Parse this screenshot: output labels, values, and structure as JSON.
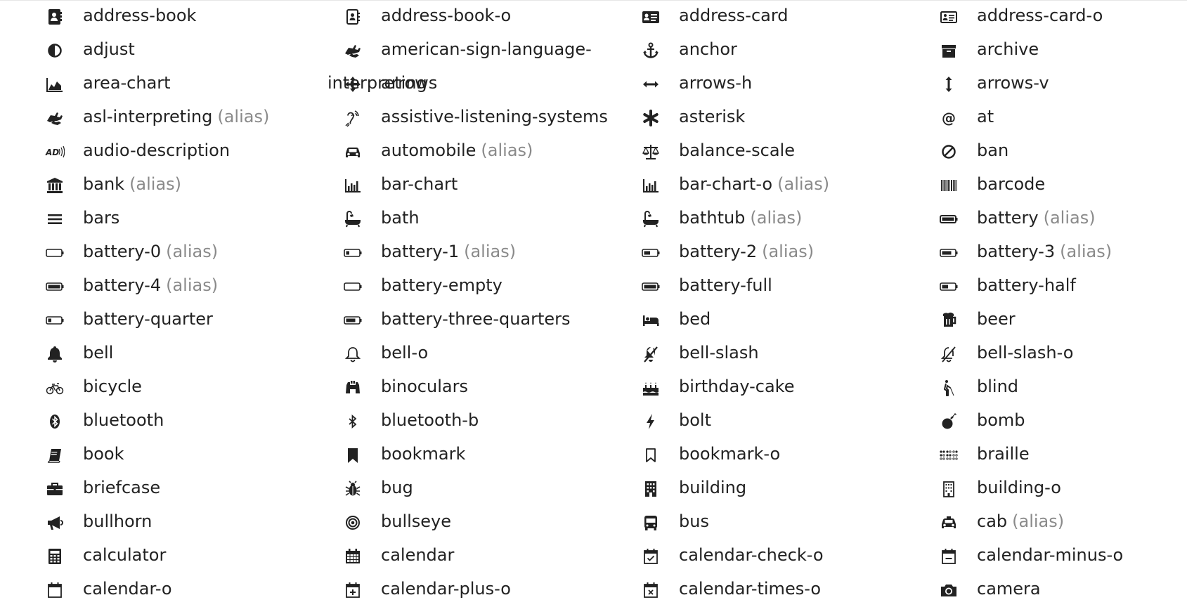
{
  "icon_list": {
    "alias_label": "(alias)",
    "items": [
      {
        "name": "address-book",
        "alias": false,
        "icon": "address-book-icon"
      },
      {
        "name": "address-book-o",
        "alias": false,
        "icon": "address-book-o-icon"
      },
      {
        "name": "address-card",
        "alias": false,
        "icon": "address-card-icon"
      },
      {
        "name": "address-card-o",
        "alias": false,
        "icon": "address-card-o-icon"
      },
      {
        "name": "adjust",
        "alias": false,
        "icon": "adjust-icon"
      },
      {
        "name": "american-sign-language-",
        "wrap_rest": "interpreting",
        "alias": false,
        "icon": "american-sign-language-interpreting-icon"
      },
      {
        "name": "anchor",
        "alias": false,
        "icon": "anchor-icon"
      },
      {
        "name": "archive",
        "alias": false,
        "icon": "archive-icon"
      },
      {
        "name": "area-chart",
        "alias": false,
        "icon": "area-chart-icon"
      },
      {
        "name": "arrows",
        "alias": false,
        "icon": "arrows-icon"
      },
      {
        "name": "arrows-h",
        "alias": false,
        "icon": "arrows-h-icon"
      },
      {
        "name": "arrows-v",
        "alias": false,
        "icon": "arrows-v-icon"
      },
      {
        "name": "asl-interpreting",
        "alias": true,
        "icon": "asl-interpreting-icon"
      },
      {
        "name": "assistive-listening-systems",
        "alias": false,
        "icon": "assistive-listening-systems-icon"
      },
      {
        "name": "asterisk",
        "alias": false,
        "icon": "asterisk-icon"
      },
      {
        "name": "at",
        "alias": false,
        "icon": "at-icon"
      },
      {
        "name": "audio-description",
        "alias": false,
        "icon": "audio-description-icon"
      },
      {
        "name": "automobile",
        "alias": true,
        "icon": "automobile-icon"
      },
      {
        "name": "balance-scale",
        "alias": false,
        "icon": "balance-scale-icon"
      },
      {
        "name": "ban",
        "alias": false,
        "icon": "ban-icon"
      },
      {
        "name": "bank",
        "alias": true,
        "icon": "bank-icon"
      },
      {
        "name": "bar-chart",
        "alias": false,
        "icon": "bar-chart-icon"
      },
      {
        "name": "bar-chart-o",
        "alias": true,
        "icon": "bar-chart-o-icon"
      },
      {
        "name": "barcode",
        "alias": false,
        "icon": "barcode-icon"
      },
      {
        "name": "bars",
        "alias": false,
        "icon": "bars-icon"
      },
      {
        "name": "bath",
        "alias": false,
        "icon": "bath-icon"
      },
      {
        "name": "bathtub",
        "alias": true,
        "icon": "bathtub-icon"
      },
      {
        "name": "battery",
        "alias": true,
        "icon": "battery-icon"
      },
      {
        "name": "battery-0",
        "alias": true,
        "icon": "battery-0-icon"
      },
      {
        "name": "battery-1",
        "alias": true,
        "icon": "battery-1-icon"
      },
      {
        "name": "battery-2",
        "alias": true,
        "icon": "battery-2-icon"
      },
      {
        "name": "battery-3",
        "alias": true,
        "icon": "battery-3-icon"
      },
      {
        "name": "battery-4",
        "alias": true,
        "icon": "battery-4-icon"
      },
      {
        "name": "battery-empty",
        "alias": false,
        "icon": "battery-empty-icon"
      },
      {
        "name": "battery-full",
        "alias": false,
        "icon": "battery-full-icon"
      },
      {
        "name": "battery-half",
        "alias": false,
        "icon": "battery-half-icon"
      },
      {
        "name": "battery-quarter",
        "alias": false,
        "icon": "battery-quarter-icon"
      },
      {
        "name": "battery-three-quarters",
        "alias": false,
        "icon": "battery-three-quarters-icon"
      },
      {
        "name": "bed",
        "alias": false,
        "icon": "bed-icon"
      },
      {
        "name": "beer",
        "alias": false,
        "icon": "beer-icon"
      },
      {
        "name": "bell",
        "alias": false,
        "icon": "bell-icon"
      },
      {
        "name": "bell-o",
        "alias": false,
        "icon": "bell-o-icon"
      },
      {
        "name": "bell-slash",
        "alias": false,
        "icon": "bell-slash-icon"
      },
      {
        "name": "bell-slash-o",
        "alias": false,
        "icon": "bell-slash-o-icon"
      },
      {
        "name": "bicycle",
        "alias": false,
        "icon": "bicycle-icon"
      },
      {
        "name": "binoculars",
        "alias": false,
        "icon": "binoculars-icon"
      },
      {
        "name": "birthday-cake",
        "alias": false,
        "icon": "birthday-cake-icon"
      },
      {
        "name": "blind",
        "alias": false,
        "icon": "blind-icon"
      },
      {
        "name": "bluetooth",
        "alias": false,
        "icon": "bluetooth-icon"
      },
      {
        "name": "bluetooth-b",
        "alias": false,
        "icon": "bluetooth-b-icon"
      },
      {
        "name": "bolt",
        "alias": false,
        "icon": "bolt-icon"
      },
      {
        "name": "bomb",
        "alias": false,
        "icon": "bomb-icon"
      },
      {
        "name": "book",
        "alias": false,
        "icon": "book-icon"
      },
      {
        "name": "bookmark",
        "alias": false,
        "icon": "bookmark-icon"
      },
      {
        "name": "bookmark-o",
        "alias": false,
        "icon": "bookmark-o-icon"
      },
      {
        "name": "braille",
        "alias": false,
        "icon": "braille-icon"
      },
      {
        "name": "briefcase",
        "alias": false,
        "icon": "briefcase-icon"
      },
      {
        "name": "bug",
        "alias": false,
        "icon": "bug-icon"
      },
      {
        "name": "building",
        "alias": false,
        "icon": "building-icon"
      },
      {
        "name": "building-o",
        "alias": false,
        "icon": "building-o-icon"
      },
      {
        "name": "bullhorn",
        "alias": false,
        "icon": "bullhorn-icon"
      },
      {
        "name": "bullseye",
        "alias": false,
        "icon": "bullseye-icon"
      },
      {
        "name": "bus",
        "alias": false,
        "icon": "bus-icon"
      },
      {
        "name": "cab",
        "alias": true,
        "icon": "cab-icon"
      },
      {
        "name": "calculator",
        "alias": false,
        "icon": "calculator-icon"
      },
      {
        "name": "calendar",
        "alias": false,
        "icon": "calendar-icon"
      },
      {
        "name": "calendar-check-o",
        "alias": false,
        "icon": "calendar-check-o-icon"
      },
      {
        "name": "calendar-minus-o",
        "alias": false,
        "icon": "calendar-minus-o-icon"
      },
      {
        "name": "calendar-o",
        "alias": false,
        "icon": "calendar-o-icon"
      },
      {
        "name": "calendar-plus-o",
        "alias": false,
        "icon": "calendar-plus-o-icon"
      },
      {
        "name": "calendar-times-o",
        "alias": false,
        "icon": "calendar-times-o-icon"
      },
      {
        "name": "camera",
        "alias": false,
        "icon": "camera-icon"
      }
    ]
  }
}
